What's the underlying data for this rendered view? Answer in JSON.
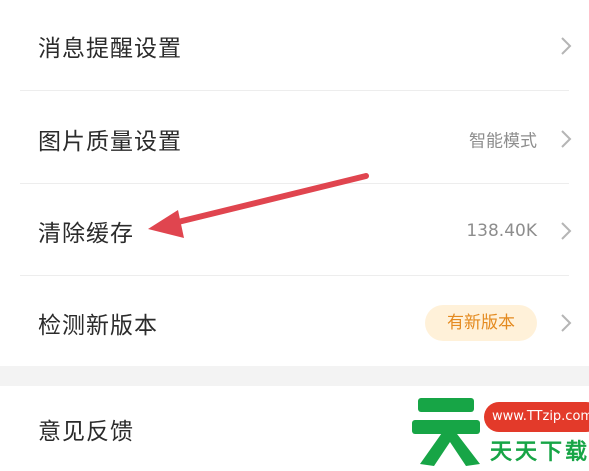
{
  "settings": {
    "notification": {
      "label": "消息提醒设置"
    },
    "image_quality": {
      "label": "图片质量设置",
      "value": "智能模式"
    },
    "clear_cache": {
      "label": "清除缓存",
      "value": "138.40K"
    },
    "check_version": {
      "label": "检测新版本",
      "badge": "有新版本"
    },
    "feedback": {
      "label": "意见反馈"
    }
  },
  "watermark": {
    "url": "www.TTzip.com",
    "name": "天天下载"
  },
  "colors": {
    "arrow": "#e0454f",
    "badge_bg": "#fff1d9",
    "badge_text": "#e48a1f",
    "watermark_red": "#e33a2a",
    "watermark_green": "#17a546"
  }
}
